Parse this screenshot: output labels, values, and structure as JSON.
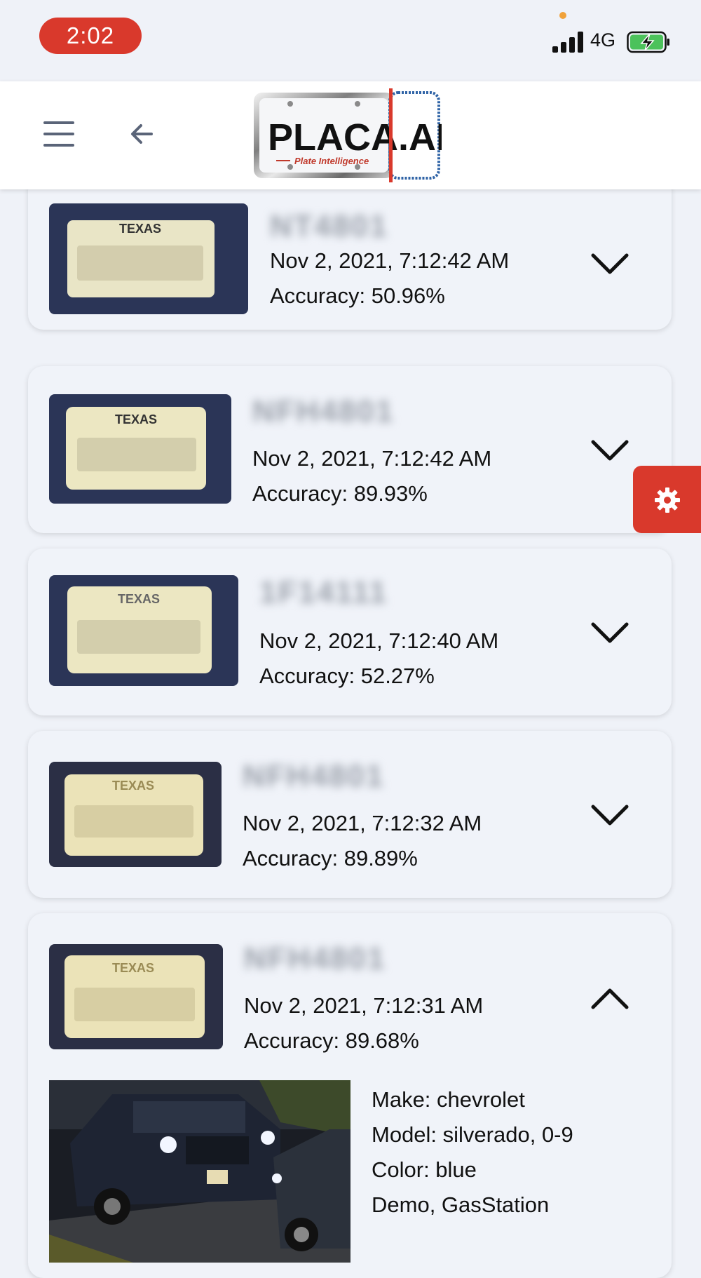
{
  "status_bar": {
    "time": "2:02",
    "network": "4G"
  },
  "header": {
    "logo_text": "PLACA.AI",
    "logo_tagline": "Plate Intelligence"
  },
  "results": [
    {
      "plate": "NT4801",
      "plate_region": "TEXAS",
      "datetime": "Nov 2, 2021, 7:12:42 AM",
      "accuracy": "Accuracy: 50.96%",
      "expanded": false
    },
    {
      "plate": "NFH4801",
      "plate_region": "TEXAS",
      "datetime": "Nov 2, 2021, 7:12:42 AM",
      "accuracy": "Accuracy: 89.93%",
      "expanded": false
    },
    {
      "plate": "1F14111",
      "plate_region": "TEXAS",
      "datetime": "Nov 2, 2021, 7:12:40 AM",
      "accuracy": "Accuracy: 52.27%",
      "expanded": false
    },
    {
      "plate": "NFH4801",
      "plate_region": "TEXAS",
      "datetime": "Nov 2, 2021, 7:12:32 AM",
      "accuracy": "Accuracy: 89.89%",
      "expanded": false
    },
    {
      "plate": "NFH4801",
      "plate_region": "TEXAS",
      "datetime": "Nov 2, 2021, 7:12:31 AM",
      "accuracy": "Accuracy: 89.68%",
      "expanded": true,
      "details": {
        "make": "Make: chevrolet",
        "model": "Model: silverado, 0-9",
        "color": "Color: blue",
        "tags": "Demo, GasStation"
      }
    }
  ],
  "icons": {
    "menu": "hamburger-icon",
    "back": "arrow-left-icon",
    "expand": "chevron-down-icon",
    "collapse": "chevron-up-icon",
    "settings": "gear-icon"
  },
  "colors": {
    "accent_red": "#d9392c",
    "background": "#eff2f8",
    "card": "#f0f3f9"
  }
}
